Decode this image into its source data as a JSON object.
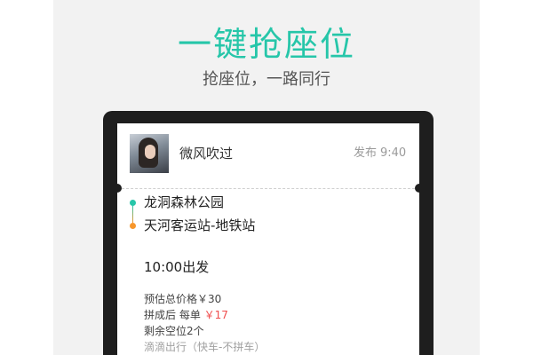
{
  "hero": {
    "title": "一键抢座位",
    "subtitle": "抢座位，一路同行"
  },
  "card": {
    "user_name": "微风吹过",
    "publish_label": "发布",
    "publish_time": "9:40",
    "route": {
      "start": "龙洞森林公园",
      "end": "天河客运站-地铁站"
    },
    "depart_time": "10:00出发",
    "estimated_total": "预估总价格￥30",
    "pool_prefix": "拼成后 每单",
    "pool_price": "￥17",
    "seats_left": "剩余空位2个",
    "service": "滴滴出行（快车-不拼车）"
  },
  "colors": {
    "accent_teal": "#26c6a9",
    "start_dot": "#26c6a9",
    "end_dot": "#f7962a",
    "price_red": "#f04d4d"
  },
  "icons": {
    "start": "start-point-dot-icon",
    "end": "end-point-dot-icon"
  }
}
